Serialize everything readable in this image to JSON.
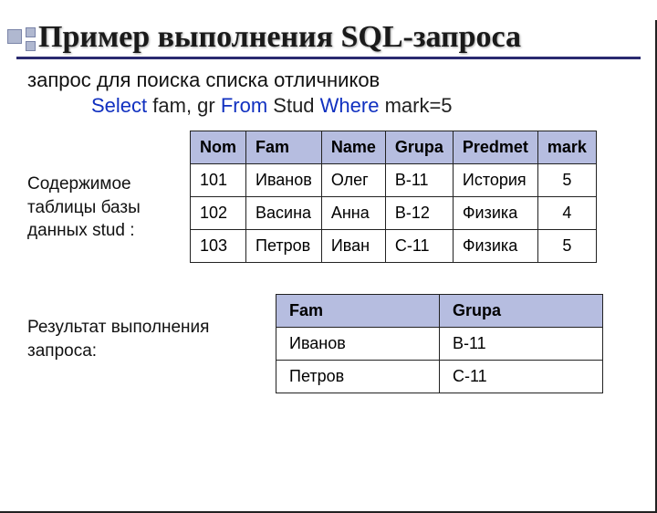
{
  "title": "Пример выполнения SQL-запроса",
  "subtitle": "запрос для поиска списка отличников",
  "sql": {
    "kw_select": "Select",
    "cols": " fam, gr ",
    "kw_from": " From",
    "table": " Stud ",
    "kw_where": " Where",
    "cond": " mark=5"
  },
  "label_studtable": "Содержимое таблицы базы данных stud :",
  "main_table": {
    "headers": [
      "Nom",
      "Fam",
      "Name",
      "Grupa",
      "Predmet",
      "mark"
    ],
    "rows": [
      [
        "101",
        "Иванов",
        "Олег",
        "В-11",
        "История",
        "5"
      ],
      [
        "102",
        "Васина",
        "Анна",
        "В-12",
        "Физика",
        "4"
      ],
      [
        "103",
        "Петров",
        "Иван",
        "С-11",
        "Физика",
        "5"
      ]
    ]
  },
  "label_result": "Результат выполнения запроса:",
  "result_table": {
    "headers": [
      "Fam",
      "Grupa"
    ],
    "rows": [
      [
        "Иванов",
        "В-11"
      ],
      [
        "Петров",
        "С-11"
      ]
    ]
  }
}
